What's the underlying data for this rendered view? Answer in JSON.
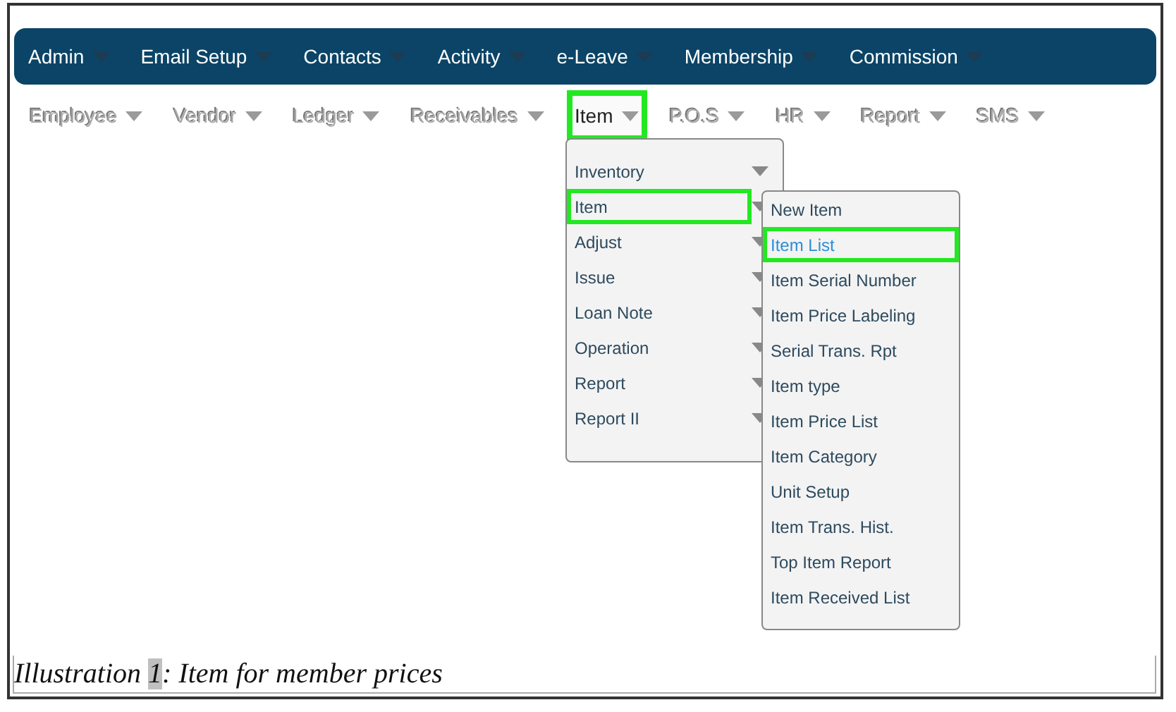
{
  "main_menu": [
    {
      "label": "Admin"
    },
    {
      "label": "Email Setup"
    },
    {
      "label": "Contacts"
    },
    {
      "label": "Activity"
    },
    {
      "label": "e-Leave"
    },
    {
      "label": "Membership"
    },
    {
      "label": "Commission"
    }
  ],
  "sub_menu": [
    {
      "label": "Employee",
      "selected": false
    },
    {
      "label": "Vendor",
      "selected": false
    },
    {
      "label": "Ledger",
      "selected": false
    },
    {
      "label": "Receivables",
      "selected": false
    },
    {
      "label": "Item",
      "selected": true
    },
    {
      "label": "P.O.S",
      "selected": false
    },
    {
      "label": "HR",
      "selected": false
    },
    {
      "label": "Report",
      "selected": false
    },
    {
      "label": "SMS",
      "selected": false
    }
  ],
  "dropdown": [
    {
      "label": "Inventory",
      "selected": false
    },
    {
      "label": "Item",
      "selected": true
    },
    {
      "label": "Adjust",
      "selected": false
    },
    {
      "label": "Issue",
      "selected": false
    },
    {
      "label": "Loan Note",
      "selected": false
    },
    {
      "label": "Operation",
      "selected": false
    },
    {
      "label": "Report",
      "selected": false
    },
    {
      "label": "Report II",
      "selected": false
    }
  ],
  "flyout": [
    {
      "label": "New Item",
      "selected": false
    },
    {
      "label": "Item List",
      "selected": true
    },
    {
      "label": "Item Serial Number",
      "selected": false
    },
    {
      "label": "Item Price Labeling",
      "selected": false
    },
    {
      "label": "Serial Trans. Rpt",
      "selected": false
    },
    {
      "label": "Item type",
      "selected": false
    },
    {
      "label": "Item Price List",
      "selected": false
    },
    {
      "label": "Item Category",
      "selected": false
    },
    {
      "label": "Unit Setup",
      "selected": false
    },
    {
      "label": "Item Trans. Hist.",
      "selected": false
    },
    {
      "label": "Top Item Report",
      "selected": false
    },
    {
      "label": "Item Received List",
      "selected": false
    }
  ],
  "caption": {
    "label": "Illustration",
    "number": "1",
    "text": ": Item for member prices"
  }
}
